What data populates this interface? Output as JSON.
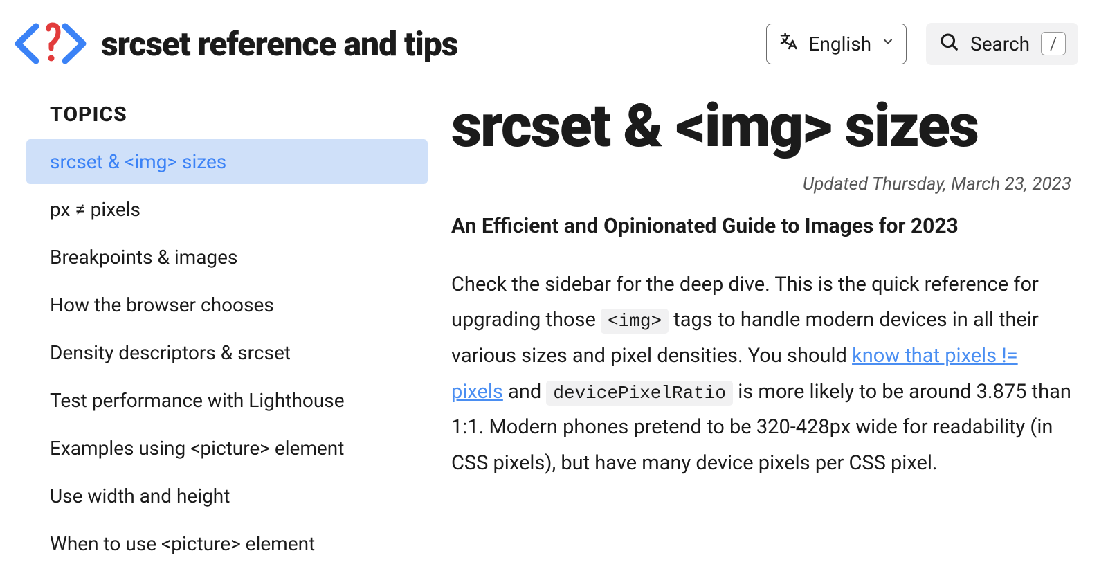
{
  "header": {
    "site_title": "srcset reference and tips",
    "language": "English",
    "search_label": "Search",
    "search_key": "/"
  },
  "sidebar": {
    "heading": "TOPICS",
    "items": [
      "srcset & <img> sizes",
      "px ≠ pixels",
      "Breakpoints & images",
      "How the browser chooses",
      "Density descriptors & srcset",
      "Test performance with Lighthouse",
      "Examples using <picture> element",
      "Use width and height",
      "When to use <picture> element"
    ]
  },
  "article": {
    "title": "srcset & <img> sizes",
    "updated": "Updated Thursday, March 23, 2023",
    "subtitle": "An Efficient and Opinionated Guide to Images for 2023",
    "p1_a": "Check the sidebar for the deep dive. This is the quick reference for upgrading those ",
    "code1": "<img>",
    "p1_b": " tags to handle modern devices in all their various sizes and pixel densities. You should ",
    "link1": "know that pixels != pixels",
    "p1_c": " and ",
    "code2": "devicePixelRatio",
    "p1_d": " is more likely to be around 3.875 than 1:1. Modern phones pretend to be 320-428px wide for readability (in CSS pixels), but have many device pixels per CSS pixel."
  }
}
